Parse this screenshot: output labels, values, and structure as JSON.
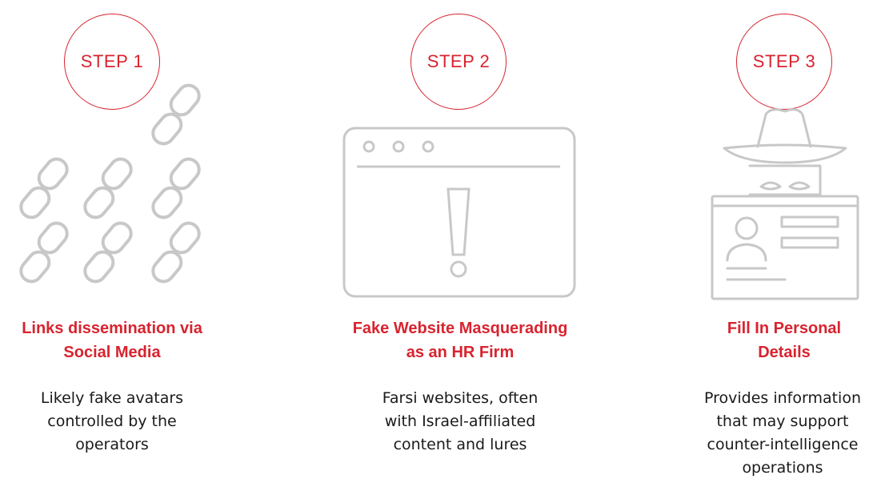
{
  "colors": {
    "accent": "#d8232f",
    "icon_stroke": "#c8c8c8",
    "text": "#1a1a1a"
  },
  "steps": [
    {
      "label": "STEP 1",
      "icon": "chain-link-icon",
      "heading_lines": [
        "Links dissemination via",
        "Social Media"
      ],
      "desc_lines": [
        "Likely fake avatars",
        "controlled by the",
        "operators"
      ]
    },
    {
      "label": "STEP 2",
      "icon": "browser-warning-icon",
      "heading_lines": [
        "Fake Website Masquerading",
        "as an HR Firm"
      ],
      "desc_lines": [
        "Farsi websites, often",
        "with Israel-affiliated",
        "content and lures"
      ]
    },
    {
      "label": "STEP 3",
      "icon": "spy-id-card-icon",
      "heading_lines": [
        "Fill In Personal",
        "Details"
      ],
      "desc_lines": [
        "Provides information",
        "that may support",
        "counter-intelligence",
        "operations"
      ]
    }
  ]
}
